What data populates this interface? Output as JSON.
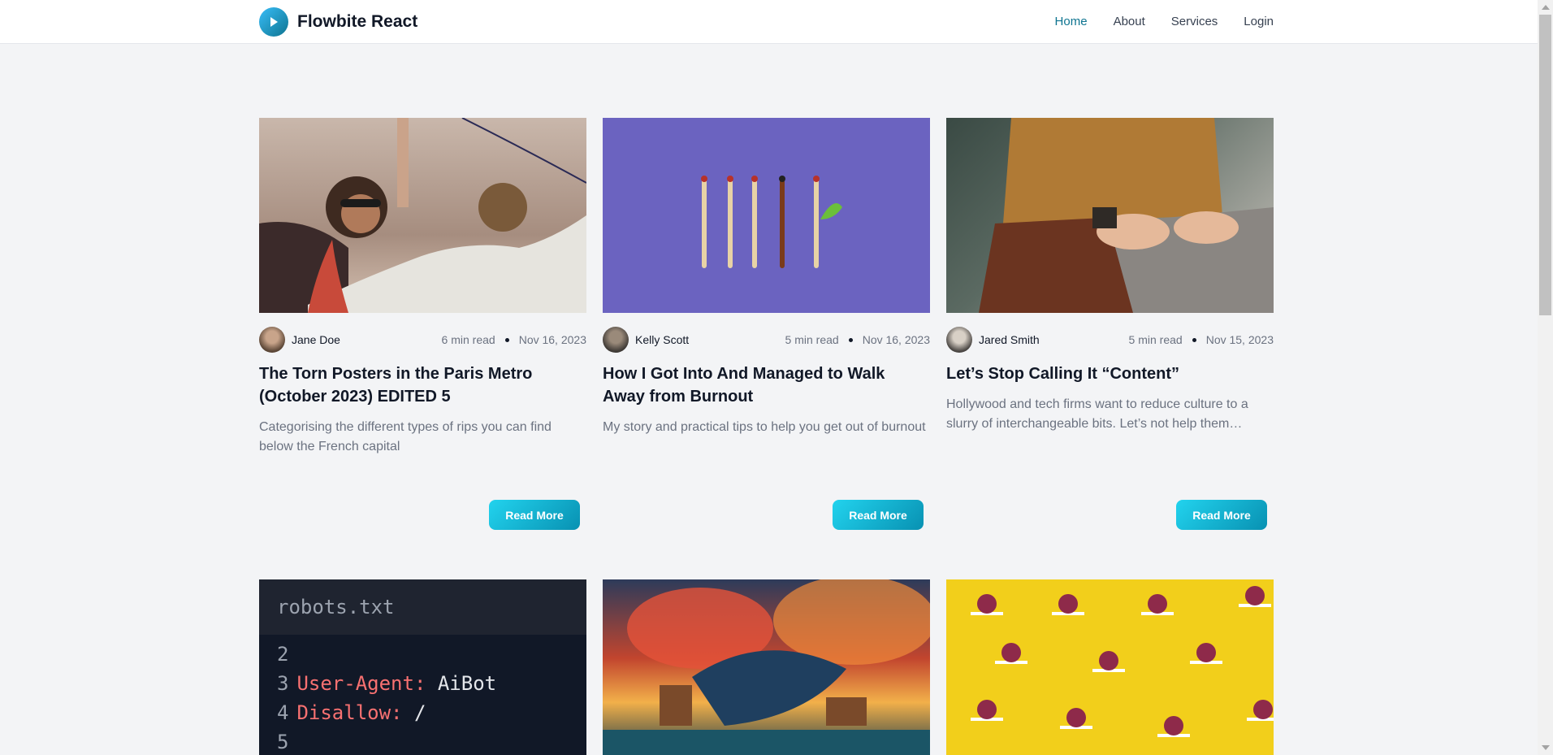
{
  "nav": {
    "brand": "Flowbite React",
    "links": [
      "Home",
      "About",
      "Services",
      "Login"
    ]
  },
  "posts": [
    {
      "author": "Jane Doe",
      "read_time": "6 min read",
      "date": "Nov 16, 2023",
      "title": "The Torn Posters in the Paris Metro (October 2023) EDITED 5",
      "desc": "Categorising the different types of rips you can find below the French capital",
      "button": "Read More"
    },
    {
      "author": "Kelly Scott",
      "read_time": "5 min read",
      "date": "Nov 16, 2023",
      "title": "How I Got Into And Managed to Walk Away from Burnout",
      "desc": "My story and practical tips to help you get out of burnout",
      "button": "Read More"
    },
    {
      "author": "Jared Smith",
      "read_time": "5 min read",
      "date": "Nov 15, 2023",
      "title": "Let’s Stop Calling It “Content”",
      "desc": "Hollywood and tech firms want to reduce culture to a slurry of interchangeable bits. Let’s not help them…",
      "button": "Read More"
    }
  ],
  "code_card": {
    "filename": "robots.txt",
    "lines": [
      {
        "num": "2",
        "key": "",
        "value": ""
      },
      {
        "num": "3",
        "key": "User-Agent:",
        "value": " AiBot"
      },
      {
        "num": "4",
        "key": "Disallow:",
        "value": " /"
      },
      {
        "num": "5",
        "key": "",
        "value": ""
      }
    ]
  },
  "colors": {
    "accent": "#0e7490",
    "button": "#06b6d4",
    "background": "#f3f4f6"
  }
}
